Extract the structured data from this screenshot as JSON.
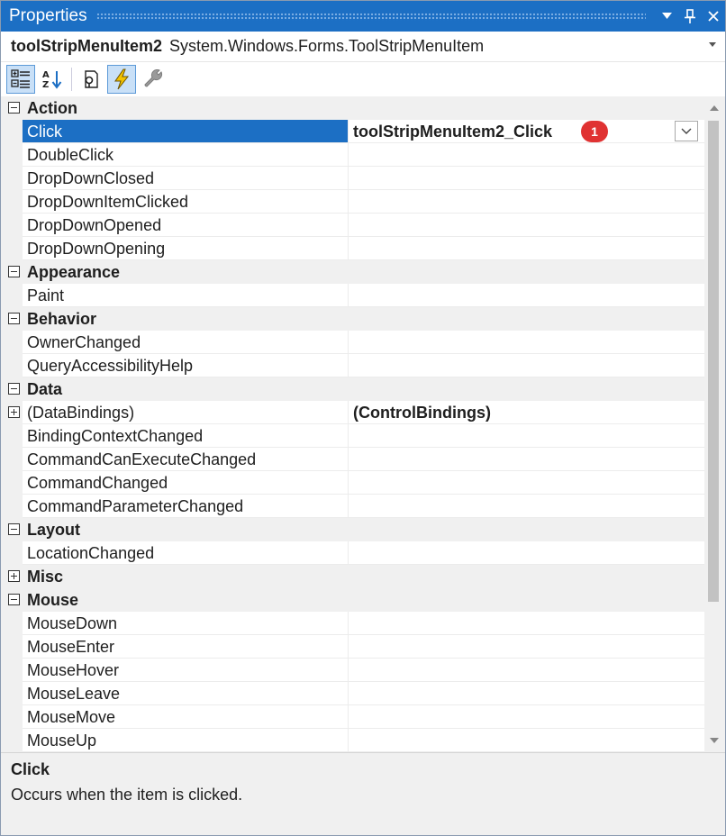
{
  "window": {
    "title": "Properties"
  },
  "object_selector": {
    "name": "toolStripMenuItem2",
    "type": "System.Windows.Forms.ToolStripMenuItem"
  },
  "toolbar": {
    "buttons": [
      {
        "icon": "categorized-icon",
        "active": true
      },
      {
        "icon": "alphabetical-icon",
        "active": false
      },
      {
        "icon": "properties-icon",
        "active": false
      },
      {
        "icon": "events-icon",
        "active": true
      },
      {
        "icon": "property-pages-icon",
        "active": false
      }
    ]
  },
  "categories": [
    {
      "label": "Action",
      "items": [
        {
          "name": "Click",
          "value": "toolStripMenuItem2_Click",
          "selected": true,
          "badge": "1"
        },
        {
          "name": "DoubleClick",
          "value": ""
        },
        {
          "name": "DropDownClosed",
          "value": ""
        },
        {
          "name": "DropDownItemClicked",
          "value": ""
        },
        {
          "name": "DropDownOpened",
          "value": ""
        },
        {
          "name": "DropDownOpening",
          "value": ""
        }
      ]
    },
    {
      "label": "Appearance",
      "items": [
        {
          "name": "Paint",
          "value": ""
        }
      ]
    },
    {
      "label": "Behavior",
      "items": [
        {
          "name": "OwnerChanged",
          "value": ""
        },
        {
          "name": "QueryAccessibilityHelp",
          "value": ""
        }
      ]
    },
    {
      "label": "Data",
      "items": [
        {
          "name": "(DataBindings)",
          "value": "(ControlBindings)",
          "expandable": true
        },
        {
          "name": "BindingContextChanged",
          "value": ""
        },
        {
          "name": "CommandCanExecuteChanged",
          "value": ""
        },
        {
          "name": "CommandChanged",
          "value": ""
        },
        {
          "name": "CommandParameterChanged",
          "value": ""
        }
      ]
    },
    {
      "label": "Layout",
      "items": [
        {
          "name": "LocationChanged",
          "value": ""
        }
      ]
    },
    {
      "label": "Misc",
      "collapsed": true,
      "items": []
    },
    {
      "label": "Mouse",
      "items": [
        {
          "name": "MouseDown",
          "value": ""
        },
        {
          "name": "MouseEnter",
          "value": ""
        },
        {
          "name": "MouseHover",
          "value": ""
        },
        {
          "name": "MouseLeave",
          "value": ""
        },
        {
          "name": "MouseMove",
          "value": ""
        },
        {
          "name": "MouseUp",
          "value": ""
        }
      ]
    }
  ],
  "description": {
    "title": "Click",
    "text": "Occurs when the item is clicked."
  },
  "colors": {
    "accent": "#1c6fc4",
    "badge": "#e03232"
  }
}
